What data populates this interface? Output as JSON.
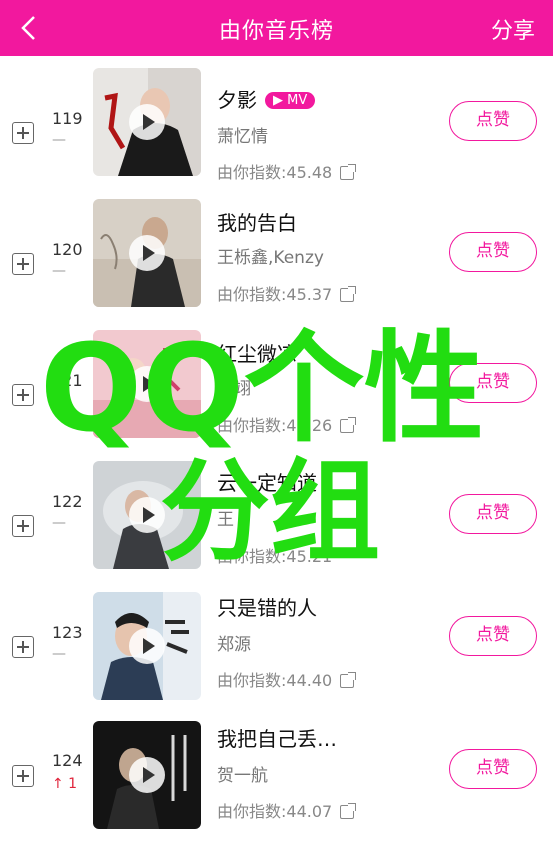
{
  "header": {
    "title": "由你音乐榜",
    "share": "分享",
    "back_icon": "chevron-left-icon",
    "bg": "#f2189e"
  },
  "rows": [
    {
      "rank": "119",
      "trend": "—",
      "title": "夕影",
      "mv": "▶ MV",
      "artist": "萧忆情",
      "index": "由你指数:45.48",
      "like": "点赞"
    },
    {
      "rank": "120",
      "trend": "—",
      "title": "我的告白",
      "artist": "王栎鑫,Kenzy",
      "index": "由你指数:45.37",
      "like": "点赞"
    },
    {
      "rank": "121",
      "trend": "—",
      "title": "红尘微凉",
      "artist": "陆翊",
      "index": "由你指数:45.26",
      "like": "点赞"
    },
    {
      "rank": "122",
      "trend": "—",
      "title": "云一定知道",
      "artist": "王",
      "index": "由你指数:45.21",
      "like": "点赞"
    },
    {
      "rank": "123",
      "trend": "—",
      "title": "只是错的人",
      "artist": "郑源",
      "index": "由你指数:44.40",
      "like": "点赞"
    },
    {
      "rank": "124",
      "trend": "↑ 1",
      "title": "我把自己丢…",
      "artist": "贺一航",
      "index": "由你指数:44.07",
      "like": "点赞"
    }
  ],
  "watermark": {
    "line1": "QQ个性",
    "line2": "分组",
    "color": "#22dd11"
  }
}
